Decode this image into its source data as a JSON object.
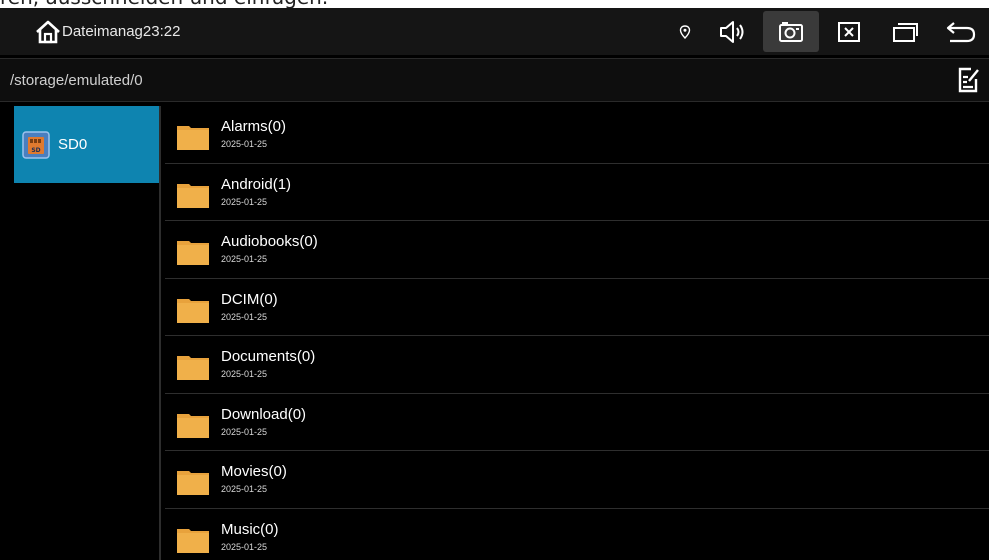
{
  "caption": "ren, ausschneiden und einfügen.",
  "statusbar": {
    "app_title": "Dateimanag",
    "clock": "23:22",
    "icons": [
      "home-icon",
      "location-icon",
      "volume-icon",
      "screenshot-icon",
      "close-window-icon",
      "recent-apps-icon",
      "back-icon"
    ]
  },
  "pathbar": {
    "path": "/storage/emulated/0",
    "edit_icon": "edit-icon"
  },
  "sidebar": {
    "items": [
      {
        "label": "SD0",
        "icon": "sd-card-icon",
        "selected": true
      }
    ]
  },
  "files": [
    {
      "name": "Alarms(0)",
      "date": "2025-01-25"
    },
    {
      "name": "Android(1)",
      "date": "2025-01-25"
    },
    {
      "name": "Audiobooks(0)",
      "date": "2025-01-25"
    },
    {
      "name": "DCIM(0)",
      "date": "2025-01-25"
    },
    {
      "name": "Documents(0)",
      "date": "2025-01-25"
    },
    {
      "name": "Download(0)",
      "date": "2025-01-25"
    },
    {
      "name": "Movies(0)",
      "date": "2025-01-25"
    },
    {
      "name": "Music(0)",
      "date": "2025-01-25"
    }
  ],
  "colors": {
    "accent": "#0e84b0",
    "folder": "#e8a23c",
    "background": "#000000"
  }
}
